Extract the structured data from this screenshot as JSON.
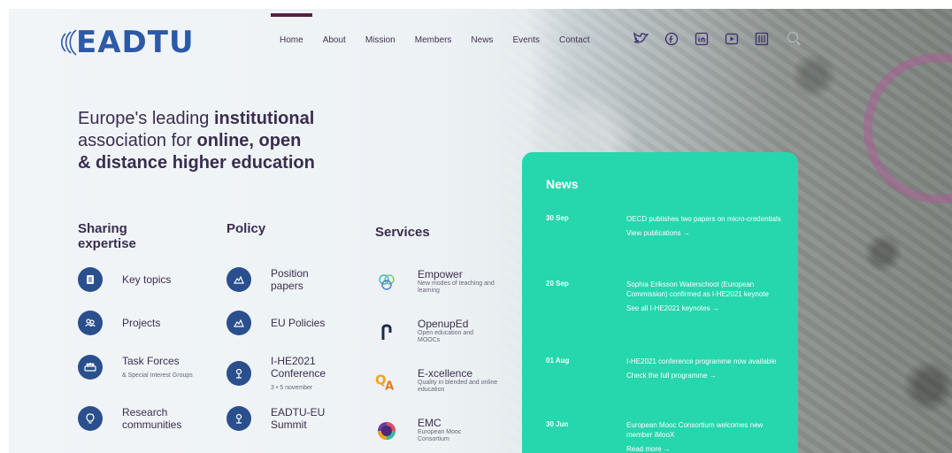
{
  "header": {
    "logo_text": "EADTU",
    "nav": [
      "Home",
      "About",
      "Mission",
      "Members",
      "News",
      "Events",
      "Contact"
    ],
    "active_nav": "Home",
    "social_icons": [
      "twitter-icon",
      "facebook-icon",
      "linkedin-icon",
      "youtube-icon",
      "flickr-icon"
    ]
  },
  "hero": {
    "line1_pre": "Europe's leading ",
    "line1_bold": "institutional",
    "line2_pre": "association for ",
    "line2_bold": "online, open",
    "line3_bold": "& distance higher education"
  },
  "sharing": {
    "title_1": "Sharing",
    "title_2": "expertise",
    "items": [
      {
        "label": "Key topics",
        "sub": "",
        "icon": "book-icon"
      },
      {
        "label": "Projects",
        "sub": "",
        "icon": "people-icon"
      },
      {
        "label": "Task Forces",
        "sub": "& Special Interest Groups",
        "icon": "group-icon"
      },
      {
        "label": "Research communities",
        "sub": "",
        "icon": "lightbulb-icon"
      }
    ]
  },
  "policy": {
    "title": "Policy",
    "items": [
      {
        "label": "Position papers",
        "sub": "",
        "icon": "hand-icon"
      },
      {
        "label": "EU Policies",
        "sub": "",
        "icon": "hand-icon"
      },
      {
        "label": "I-HE2021 Conference",
        "sub": "3 • 5 november",
        "icon": "podium-icon"
      },
      {
        "label": "EADTU-EU Summit",
        "sub": "",
        "icon": "podium-icon"
      }
    ]
  },
  "services": {
    "title": "Services",
    "items": [
      {
        "label": "Empower",
        "sub": "New modes of teaching and learning",
        "icon": "empower-logo-icon"
      },
      {
        "label": "OpenupEd",
        "sub": "Open education and MOOCs",
        "icon": "openuped-logo-icon"
      },
      {
        "label": "E-xcellence",
        "sub": "Quality in blended and online education",
        "icon": "qa-logo-icon"
      },
      {
        "label": "EMC",
        "sub": "European Mooc Consortium",
        "icon": "emc-logo-icon"
      }
    ]
  },
  "news": {
    "title": "News",
    "items": [
      {
        "date": "30 Sep",
        "text": "OECD publishes two papers on micro-credentials",
        "link": "View publications →"
      },
      {
        "date": "20 Sep",
        "text": "Sophia Eriksson Waterschoot (European Commission) confirmed as I-HE2021 keynote",
        "link": "See all I-HE2021 keynotes →"
      },
      {
        "date": "01 Aug",
        "text": "I-HE2021 conference programme now available",
        "link": "Check the full programme →"
      },
      {
        "date": "30 Jun",
        "text": "European Mooc Consortium welcomes new member iMooX",
        "link": "Read more →"
      }
    ]
  },
  "colors": {
    "brand_blue": "#2d5aa6",
    "icon_navy": "#2a4f8c",
    "news_green": "#26d6ad",
    "accent_purple": "#5a1f45"
  }
}
